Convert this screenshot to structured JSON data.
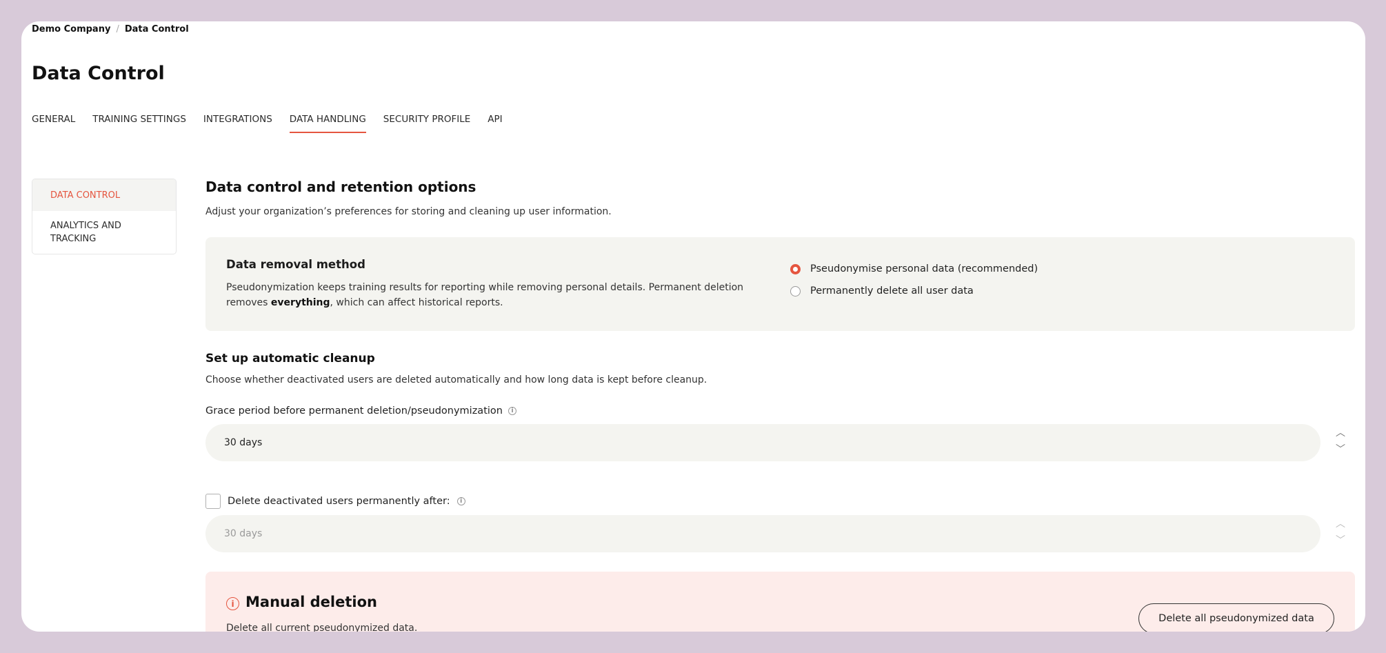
{
  "breadcrumb": {
    "company": "Demo Company",
    "separator": "/",
    "current": "Data Control"
  },
  "page": {
    "title": "Data Control"
  },
  "tabs": [
    {
      "label": "GENERAL"
    },
    {
      "label": "TRAINING SETTINGS"
    },
    {
      "label": "INTEGRATIONS"
    },
    {
      "label": "DATA HANDLING",
      "active": true
    },
    {
      "label": "SECURITY PROFILE"
    },
    {
      "label": "API"
    }
  ],
  "subnav": {
    "items": [
      {
        "label": "DATA CONTROL",
        "active": true
      },
      {
        "label": "ANALYTICS AND TRACKING"
      }
    ]
  },
  "section": {
    "title": "Data control and retention options",
    "description": "Adjust your organization’s preferences for storing and cleaning up user information."
  },
  "removal": {
    "title": "Data removal method",
    "desc_part1": "Pseudonymization keeps training results for reporting while removing personal details. Permanent deletion removes ",
    "desc_bold": "everything",
    "desc_part2": ", which can affect historical reports.",
    "options": [
      {
        "label": "Pseudonymise personal data (recommended)",
        "selected": true
      },
      {
        "label": "Permanently delete all user data",
        "selected": false
      }
    ]
  },
  "cleanup": {
    "title": "Set up automatic cleanup",
    "description": "Choose whether deactivated users are deleted automatically and how long data is kept before cleanup.",
    "grace_label": "Grace period before permanent deletion/pseudonymization",
    "grace_value": "30 days",
    "delete_label": "Delete deactivated users permanently after:",
    "delete_checked": false,
    "delete_value": "30 days"
  },
  "manual": {
    "title": "Manual deletion",
    "description": "Delete all current pseudonymized data.",
    "button_label": "Delete all pseudonymized data"
  },
  "colors": {
    "accent": "#e5553f",
    "panel": "#f4f4f0",
    "danger_panel": "#fdecea",
    "outer": "#d8cad9"
  },
  "icons": {
    "info": "info-icon",
    "warning": "warning-icon",
    "spinner_up": "chevron-up-icon",
    "spinner_down": "chevron-down-icon"
  }
}
